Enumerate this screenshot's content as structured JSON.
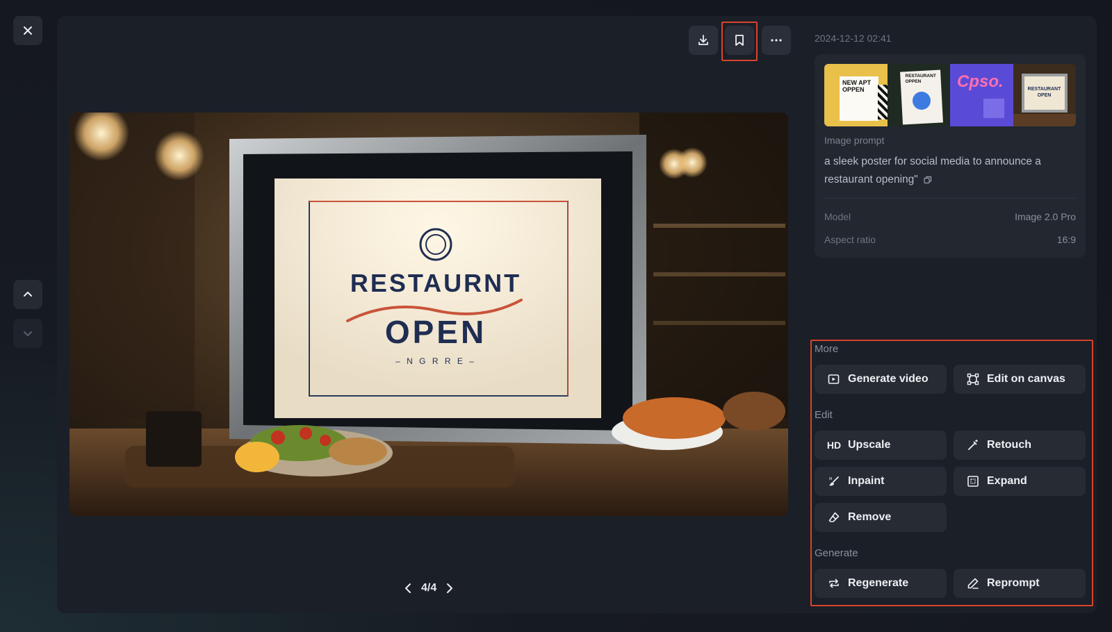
{
  "header": {
    "timestamp": "2024-12-12 02:41"
  },
  "pager": {
    "label": "4/4"
  },
  "main_image": {
    "sign_title": "RESTAURNT",
    "sign_subtitle": "OPEN",
    "sign_tag": "– N G R R E –"
  },
  "thumbnails": [
    {
      "text": "NEW APT OPPEN"
    },
    {
      "text": "RESTAURANT OPPEN"
    },
    {
      "text": "Cpso."
    },
    {
      "text": "RESTAURANT OPEN"
    }
  ],
  "info": {
    "prompt_label": "Image prompt",
    "prompt_text": "a sleek poster for social media to announce a restaurant opening\"",
    "model_label": "Model",
    "model_value": "Image 2.0 Pro",
    "aspect_label": "Aspect ratio",
    "aspect_value": "16:9"
  },
  "sections": {
    "more": "More",
    "edit": "Edit",
    "generate": "Generate"
  },
  "actions": {
    "generate_video": "Generate video",
    "edit_on_canvas": "Edit on canvas",
    "upscale": "Upscale",
    "upscale_icon_text": "HD",
    "retouch": "Retouch",
    "inpaint": "Inpaint",
    "expand": "Expand",
    "remove": "Remove",
    "regenerate": "Regenerate",
    "reprompt": "Reprompt"
  },
  "colors": {
    "highlight": "#d9442b",
    "panel": "#1b1f27",
    "button": "#262b34"
  }
}
